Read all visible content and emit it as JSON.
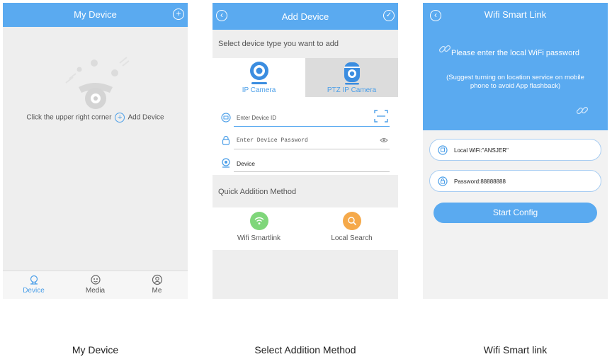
{
  "screen1": {
    "title": "My Device",
    "add_icon": "plus-circle-icon",
    "empty_hint_prefix": "Click the upper right corner",
    "empty_hint_suffix": "Add Device",
    "tabs": [
      {
        "label": "Device",
        "icon": "device-icon",
        "active": true
      },
      {
        "label": "Media",
        "icon": "media-icon",
        "active": false
      },
      {
        "label": "Me",
        "icon": "user-icon",
        "active": false
      }
    ]
  },
  "screen2": {
    "title": "Add Device",
    "select_label": "Select device type you want to add",
    "types": [
      {
        "label": "IP Camera",
        "icon": "ip-camera-icon",
        "selected": true
      },
      {
        "label": "PTZ IP Camera",
        "icon": "ptz-camera-icon",
        "selected": false
      }
    ],
    "device_id_placeholder": "Enter Device ID",
    "password_placeholder": "Enter Device Password",
    "device_name_value": "Device",
    "quick_label": "Quick Addition Method",
    "quick_options": [
      {
        "label": "Wifi Smartlink",
        "icon": "wifi-icon",
        "color": "#7fd67a"
      },
      {
        "label": "Local Search",
        "icon": "search-icon",
        "color": "#f5a94a"
      }
    ]
  },
  "screen3": {
    "title": "Wifi Smart Link",
    "prompt": "Please enter the local WiFi password",
    "note": "(Suggest turning on location service on mobile phone to avoid App flashback)",
    "wifi_value": "Local WiFi:\"ANSJER\"",
    "password_value": "Password:88888888",
    "start_label": "Start Config"
  },
  "captions": [
    "My Device",
    "Select Addition Method",
    "Wifi Smart link"
  ],
  "colors": {
    "accent": "#5aaaf0",
    "wifi_green": "#7fd67a",
    "search_orange": "#f5a94a"
  }
}
